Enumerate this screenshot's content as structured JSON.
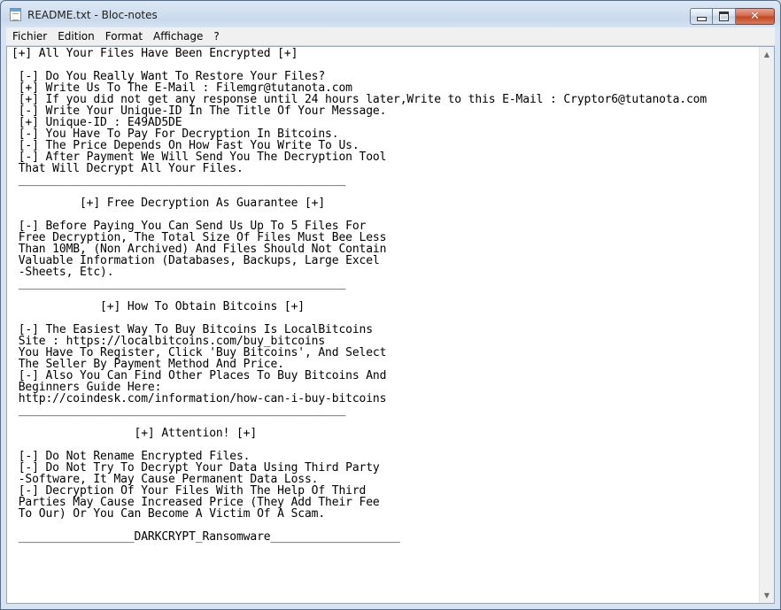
{
  "window": {
    "title": "README.txt - Bloc-notes",
    "controls": {
      "minimize_icon": "minimize-icon",
      "maximize_icon": "maximize-icon",
      "close_icon": "close-icon",
      "close_glyph": "✕"
    }
  },
  "menu": {
    "items": [
      {
        "label": "Fichier"
      },
      {
        "label": "Edition"
      },
      {
        "label": "Format"
      },
      {
        "label": "Affichage"
      },
      {
        "label": "?"
      }
    ]
  },
  "document": {
    "lines": [
      "[+] All Your Files Have Been Encrypted [+]",
      "",
      " [-] Do You Really Want To Restore Your Files?",
      " [+] Write Us To The E-Mail : Filemgr@tutanota.com",
      " [+] If you did not get any response until 24 hours later,Write to this E-Mail : Cryptor6@tutanota.com",
      " [-] Write Your Unique-ID In The Title Of Your Message.",
      " [+] Unique-ID : E49AD5DE",
      " [-] You Have To Pay For Decryption In Bitcoins.",
      " [-] The Price Depends On How Fast You Write To Us.",
      " [-] After Payment We Will Send You The Decryption Tool",
      " That Will Decrypt All Your Files.",
      " ________________________________________________",
      "",
      "          [+] Free Decryption As Guarantee [+]",
      "",
      " [-] Before Paying You Can Send Us Up To 5 Files For",
      " Free Decryption, The Total Size Of Files Must Bee Less",
      " Than 10MB, (Non Archived) And Files Should Not Contain",
      " Valuable Information (Databases, Backups, Large Excel",
      " -Sheets, Etc).",
      " ________________________________________________",
      "",
      "             [+] How To Obtain Bitcoins [+]",
      "",
      " [-] The Easiest Way To Buy Bitcoins Is LocalBitcoins",
      " Site : https://localbitcoins.com/buy_bitcoins",
      " You Have To Register, Click 'Buy Bitcoins', And Select",
      " The Seller By Payment Method And Price.",
      " [-] Also You Can Find Other Places To Buy Bitcoins And",
      " Beginners Guide Here:",
      " http://coindesk.com/information/how-can-i-buy-bitcoins",
      " ________________________________________________",
      "",
      "                  [+] Attention! [+]",
      "",
      " [-] Do Not Rename Encrypted Files.",
      " [-] Do Not Try To Decrypt Your Data Using Third Party",
      " -Software, It May Cause Permanent Data Loss.",
      " [-] Decryption Of Your Files With The Help Of Third",
      " Parties May Cause Increased Price (They Add Their Fee",
      " To Our) Or You Can Become A Victim Of A Scam.",
      "",
      " _________________DARKCRYPT_Ransomware___________________"
    ]
  },
  "scrollbar": {
    "up_glyph": "▲",
    "down_glyph": "▼"
  }
}
